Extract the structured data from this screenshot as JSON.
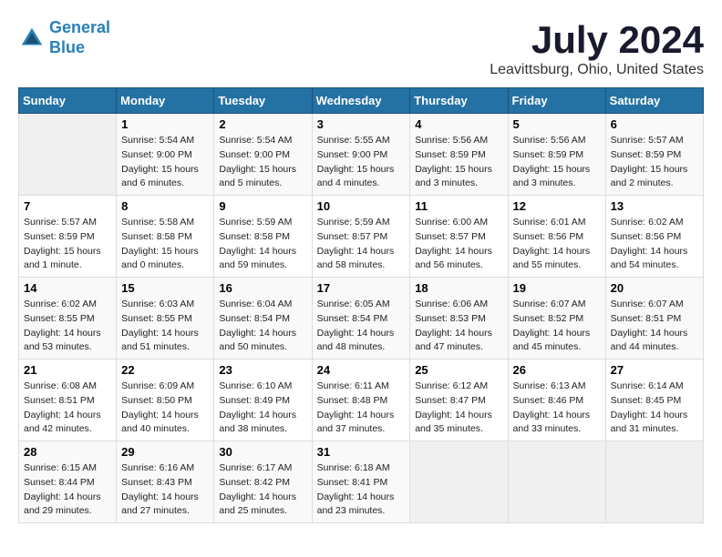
{
  "logo": {
    "line1": "General",
    "line2": "Blue"
  },
  "title": "July 2024",
  "location": "Leavittsburg, Ohio, United States",
  "days_of_week": [
    "Sunday",
    "Monday",
    "Tuesday",
    "Wednesday",
    "Thursday",
    "Friday",
    "Saturday"
  ],
  "weeks": [
    [
      {
        "day": "",
        "info": ""
      },
      {
        "day": "1",
        "info": "Sunrise: 5:54 AM\nSunset: 9:00 PM\nDaylight: 15 hours\nand 6 minutes."
      },
      {
        "day": "2",
        "info": "Sunrise: 5:54 AM\nSunset: 9:00 PM\nDaylight: 15 hours\nand 5 minutes."
      },
      {
        "day": "3",
        "info": "Sunrise: 5:55 AM\nSunset: 9:00 PM\nDaylight: 15 hours\nand 4 minutes."
      },
      {
        "day": "4",
        "info": "Sunrise: 5:56 AM\nSunset: 8:59 PM\nDaylight: 15 hours\nand 3 minutes."
      },
      {
        "day": "5",
        "info": "Sunrise: 5:56 AM\nSunset: 8:59 PM\nDaylight: 15 hours\nand 3 minutes."
      },
      {
        "day": "6",
        "info": "Sunrise: 5:57 AM\nSunset: 8:59 PM\nDaylight: 15 hours\nand 2 minutes."
      }
    ],
    [
      {
        "day": "7",
        "info": "Sunrise: 5:57 AM\nSunset: 8:59 PM\nDaylight: 15 hours\nand 1 minute."
      },
      {
        "day": "8",
        "info": "Sunrise: 5:58 AM\nSunset: 8:58 PM\nDaylight: 15 hours\nand 0 minutes."
      },
      {
        "day": "9",
        "info": "Sunrise: 5:59 AM\nSunset: 8:58 PM\nDaylight: 14 hours\nand 59 minutes."
      },
      {
        "day": "10",
        "info": "Sunrise: 5:59 AM\nSunset: 8:57 PM\nDaylight: 14 hours\nand 58 minutes."
      },
      {
        "day": "11",
        "info": "Sunrise: 6:00 AM\nSunset: 8:57 PM\nDaylight: 14 hours\nand 56 minutes."
      },
      {
        "day": "12",
        "info": "Sunrise: 6:01 AM\nSunset: 8:56 PM\nDaylight: 14 hours\nand 55 minutes."
      },
      {
        "day": "13",
        "info": "Sunrise: 6:02 AM\nSunset: 8:56 PM\nDaylight: 14 hours\nand 54 minutes."
      }
    ],
    [
      {
        "day": "14",
        "info": "Sunrise: 6:02 AM\nSunset: 8:55 PM\nDaylight: 14 hours\nand 53 minutes."
      },
      {
        "day": "15",
        "info": "Sunrise: 6:03 AM\nSunset: 8:55 PM\nDaylight: 14 hours\nand 51 minutes."
      },
      {
        "day": "16",
        "info": "Sunrise: 6:04 AM\nSunset: 8:54 PM\nDaylight: 14 hours\nand 50 minutes."
      },
      {
        "day": "17",
        "info": "Sunrise: 6:05 AM\nSunset: 8:54 PM\nDaylight: 14 hours\nand 48 minutes."
      },
      {
        "day": "18",
        "info": "Sunrise: 6:06 AM\nSunset: 8:53 PM\nDaylight: 14 hours\nand 47 minutes."
      },
      {
        "day": "19",
        "info": "Sunrise: 6:07 AM\nSunset: 8:52 PM\nDaylight: 14 hours\nand 45 minutes."
      },
      {
        "day": "20",
        "info": "Sunrise: 6:07 AM\nSunset: 8:51 PM\nDaylight: 14 hours\nand 44 minutes."
      }
    ],
    [
      {
        "day": "21",
        "info": "Sunrise: 6:08 AM\nSunset: 8:51 PM\nDaylight: 14 hours\nand 42 minutes."
      },
      {
        "day": "22",
        "info": "Sunrise: 6:09 AM\nSunset: 8:50 PM\nDaylight: 14 hours\nand 40 minutes."
      },
      {
        "day": "23",
        "info": "Sunrise: 6:10 AM\nSunset: 8:49 PM\nDaylight: 14 hours\nand 38 minutes."
      },
      {
        "day": "24",
        "info": "Sunrise: 6:11 AM\nSunset: 8:48 PM\nDaylight: 14 hours\nand 37 minutes."
      },
      {
        "day": "25",
        "info": "Sunrise: 6:12 AM\nSunset: 8:47 PM\nDaylight: 14 hours\nand 35 minutes."
      },
      {
        "day": "26",
        "info": "Sunrise: 6:13 AM\nSunset: 8:46 PM\nDaylight: 14 hours\nand 33 minutes."
      },
      {
        "day": "27",
        "info": "Sunrise: 6:14 AM\nSunset: 8:45 PM\nDaylight: 14 hours\nand 31 minutes."
      }
    ],
    [
      {
        "day": "28",
        "info": "Sunrise: 6:15 AM\nSunset: 8:44 PM\nDaylight: 14 hours\nand 29 minutes."
      },
      {
        "day": "29",
        "info": "Sunrise: 6:16 AM\nSunset: 8:43 PM\nDaylight: 14 hours\nand 27 minutes."
      },
      {
        "day": "30",
        "info": "Sunrise: 6:17 AM\nSunset: 8:42 PM\nDaylight: 14 hours\nand 25 minutes."
      },
      {
        "day": "31",
        "info": "Sunrise: 6:18 AM\nSunset: 8:41 PM\nDaylight: 14 hours\nand 23 minutes."
      },
      {
        "day": "",
        "info": ""
      },
      {
        "day": "",
        "info": ""
      },
      {
        "day": "",
        "info": ""
      }
    ]
  ]
}
